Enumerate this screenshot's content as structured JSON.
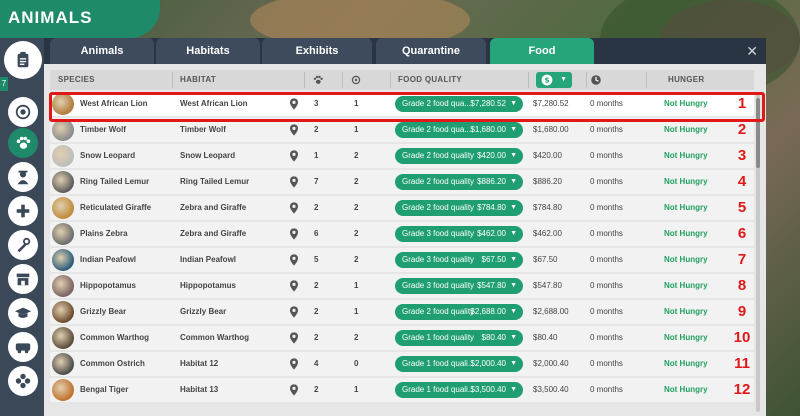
{
  "title": "ANIMALS",
  "sidebar_badge": "7",
  "sidebar_icons": [
    "clipboard-icon",
    "pen-icon",
    "paw-icon",
    "keeper-icon",
    "vet-icon",
    "mechanic-icon",
    "shop-icon",
    "education-icon",
    "transport-icon",
    "flower-icon"
  ],
  "tabs": [
    {
      "label": "Animals",
      "active": false
    },
    {
      "label": "Habitats",
      "active": false
    },
    {
      "label": "Exhibits",
      "active": false
    },
    {
      "label": "Quarantine",
      "active": false
    },
    {
      "label": "Food",
      "active": true
    }
  ],
  "columns": {
    "species": "SPECIES",
    "habitat": "HABITAT",
    "food_quality": "FOOD QUALITY",
    "hunger": "HUNGER"
  },
  "colors": {
    "accent": "#26a57a",
    "hungry": "#22a05f",
    "highlight": "#e01818"
  },
  "rows": [
    {
      "num": "1",
      "species": "West African Lion",
      "habitat": "West African Lion",
      "count": "3",
      "other": "1",
      "food": "Grade 2 food qua...",
      "price": "$7,280.52",
      "cost": "$7,280.52",
      "time": "0 months",
      "hunger": "Not Hungry",
      "avatar": "#b07a3a"
    },
    {
      "num": "2",
      "species": "Timber Wolf",
      "habitat": "Timber Wolf",
      "count": "2",
      "other": "1",
      "food": "Grade 2 food qua...",
      "price": "$1,680.00",
      "cost": "$1,680.00",
      "time": "0 months",
      "hunger": "Not Hungry",
      "avatar": "#8a8a8a"
    },
    {
      "num": "3",
      "species": "Snow Leopard",
      "habitat": "Snow Leopard",
      "count": "1",
      "other": "2",
      "food": "Grade 2 food quality",
      "price": "$420.00",
      "cost": "$420.00",
      "time": "0 months",
      "hunger": "Not Hungry",
      "avatar": "#bdbdbd"
    },
    {
      "num": "4",
      "species": "Ring Tailed Lemur",
      "habitat": "Ring Tailed Lemur",
      "count": "7",
      "other": "2",
      "food": "Grade 2 food quality",
      "price": "$886.20",
      "cost": "$886.20",
      "time": "0 months",
      "hunger": "Not Hungry",
      "avatar": "#5a5a5a"
    },
    {
      "num": "5",
      "species": "Reticulated Giraffe",
      "habitat": "Zebra and Giraffe",
      "count": "2",
      "other": "2",
      "food": "Grade 2 food quality",
      "price": "$784.80",
      "cost": "$784.80",
      "time": "0 months",
      "hunger": "Not Hungry",
      "avatar": "#c08a3a"
    },
    {
      "num": "6",
      "species": "Plains Zebra",
      "habitat": "Zebra and Giraffe",
      "count": "6",
      "other": "2",
      "food": "Grade 3 food quality",
      "price": "$462.00",
      "cost": "$462.00",
      "time": "0 months",
      "hunger": "Not Hungry",
      "avatar": "#6a6a6a"
    },
    {
      "num": "7",
      "species": "Indian Peafowl",
      "habitat": "Indian Peafowl",
      "count": "5",
      "other": "2",
      "food": "Grade 3 food quality",
      "price": "$67.50",
      "cost": "$67.50",
      "time": "0 months",
      "hunger": "Not Hungry",
      "avatar": "#2a5a7a"
    },
    {
      "num": "8",
      "species": "Hippopotamus",
      "habitat": "Hippopotamus",
      "count": "2",
      "other": "1",
      "food": "Grade 3 food quality",
      "price": "$547.80",
      "cost": "$547.80",
      "time": "0 months",
      "hunger": "Not Hungry",
      "avatar": "#7a6060"
    },
    {
      "num": "9",
      "species": "Grizzly Bear",
      "habitat": "Grizzly Bear",
      "count": "2",
      "other": "1",
      "food": "Grade 2 food quality",
      "price": "$2,688.00",
      "cost": "$2,688.00",
      "time": "0 months",
      "hunger": "Not Hungry",
      "avatar": "#6a4a2a"
    },
    {
      "num": "10",
      "species": "Common Warthog",
      "habitat": "Common Warthog",
      "count": "2",
      "other": "2",
      "food": "Grade 1 food quality",
      "price": "$80.40",
      "cost": "$80.40",
      "time": "0 months",
      "hunger": "Not Hungry",
      "avatar": "#5a4a3a"
    },
    {
      "num": "11",
      "species": "Common Ostrich",
      "habitat": "Habitat 12",
      "count": "4",
      "other": "0",
      "food": "Grade 1 food quali...",
      "price": "$2,000.40",
      "cost": "$2,000.40",
      "time": "0 months",
      "hunger": "Not Hungry",
      "avatar": "#4a4a4a"
    },
    {
      "num": "12",
      "species": "Bengal Tiger",
      "habitat": "Habitat 13",
      "count": "2",
      "other": "1",
      "food": "Grade 1 food quali...",
      "price": "$3,500.40",
      "cost": "$3,500.40",
      "time": "0 months",
      "hunger": "Not Hungry",
      "avatar": "#c0702a"
    }
  ]
}
